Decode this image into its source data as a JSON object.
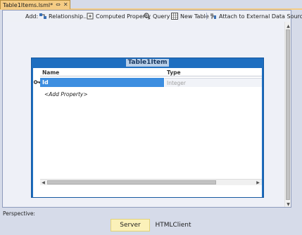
{
  "document_tab": {
    "title": "Table1Items.lsml*",
    "pin_glyph": "⇔",
    "close_glyph": "✕"
  },
  "toolbar": {
    "add_label": "Add:",
    "relationship_label": "Relationship...",
    "computed_property_label": "Computed Property",
    "query_label": "Query",
    "new_table_label": "New Table",
    "attach_label": "Attach to External Data Source..."
  },
  "entity": {
    "title": "Table1Item",
    "columns": {
      "name": "Name",
      "type": "Type"
    },
    "rows": [
      {
        "name": "Id",
        "type": "Integer",
        "is_key": true
      }
    ],
    "add_property_label": "<Add Property>"
  },
  "perspective": {
    "label": "Perspective:",
    "options": [
      "Server",
      "HTMLClient"
    ],
    "selected": "Server"
  },
  "colors": {
    "tab_active": "#f5cc84",
    "entity_header": "#1e6ec0",
    "row_selected": "#3d8ee0",
    "perspective_selected": "#fbf1b9"
  }
}
